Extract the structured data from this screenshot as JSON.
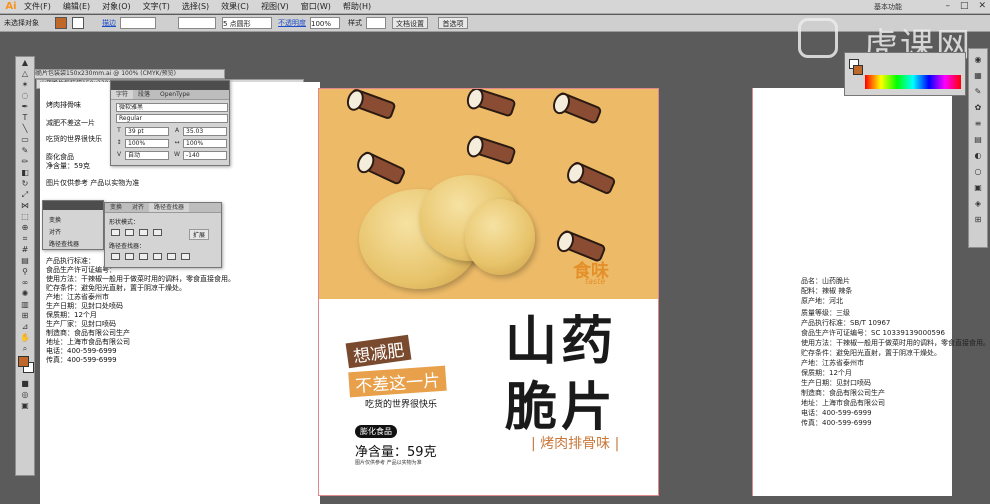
{
  "app": {
    "logo": "Ai",
    "workspace": "基本功能"
  },
  "menu": [
    "文件(F)",
    "编辑(E)",
    "对象(O)",
    "文字(T)",
    "选择(S)",
    "效果(C)",
    "视图(V)",
    "窗口(W)",
    "帮助(H)"
  ],
  "control_bar": {
    "no_selection": "未选择对象",
    "stroke_label": "描边",
    "brush_size": "5 点圆形",
    "opacity_label": "不透明度",
    "opacity_value": "100%",
    "style_label": "样式",
    "doc_setup": "文档设置",
    "preferences": "首选项"
  },
  "brand": {
    "name": "虎课网"
  },
  "doc_tabs": [
    "山药脆片包装袋150x230mm.ai @ 100% (CMYK/预览)",
    "山药脆片包装袋150x230mm.ai @ 166% (CMYK/预览)"
  ],
  "left_doc": {
    "lines": [
      "烤肉排骨味",
      "减肥不差这一片",
      "吃货的世界很快乐",
      "膨化食品",
      "净含量：59克",
      "图片仅供参考 产品以实物为准"
    ],
    "info": [
      "产品执行标准：",
      "食品生产许可证编号：",
      "使用方法：干辣椒一般用于做菜时用的调料，零食直接食用。",
      "贮存条件：避免阳光直射，置于阴凉干燥处。",
      "产地：江苏省泰州市",
      "生产日期：见封口处喷码",
      "保质期：12个月",
      "生产厂家：见封口喷码",
      "制造商：食品有限公司生产",
      "地址：上海市食品有限公司",
      "电话：400-599-6999",
      "传真：400-599-6999"
    ]
  },
  "char_panel": {
    "tabs": [
      "字符",
      "段落",
      "OpenType"
    ],
    "font_family": "微软雅黑",
    "font_style": "Regular",
    "font_size": "39 pt",
    "leading": "35.03",
    "h_scale": "100%",
    "v_scale": "100%",
    "kerning": "自动",
    "tracking": "-140"
  },
  "pathfinder_panel": {
    "tabs": [
      "变换",
      "对齐",
      "路径查找器"
    ],
    "shape_modes": "形状模式：",
    "pathfinders": "路径查找器：",
    "expand": "扩展"
  },
  "mini_list": [
    "变换",
    "对齐",
    "路径查找器"
  ],
  "package": {
    "logo": "食味",
    "logo_sub": "taste",
    "title_line1": "山药",
    "title_line2": "脆片",
    "flavor": "| 烤肉排骨味 |",
    "stamp_line1": "想减肥",
    "stamp_line2": "不差这一片",
    "slogan": "吃货的世界很快乐",
    "badge": "膨化食品",
    "weight": "净含量：59克",
    "fine_print": "图片仅供参考 产品以实物为准",
    "colors": {
      "band": "#edbb68",
      "accent": "#c9783a",
      "yam": "#8a4d33"
    }
  },
  "right_doc": {
    "lines": [
      "品名：山药脆片",
      "配料：辣椒 辣条",
      "原产地：河北",
      "质量等级：三级",
      "产品执行标准：SB/T 10967",
      "食品生产许可证编号：SC 10339139000596",
      "使用方法：干辣椒一般用于做菜时用的调料，零食直接食用。",
      "贮存条件：避免阳光直射，置于阴凉干燥处。",
      "产地：江苏省泰州市",
      "保质期：12个月",
      "生产日期：见封口喷码",
      "制造商：食品有限公司生产",
      "地址：上海市食品有限公司",
      "电话：400-599-6999",
      "传真：400-599-6999"
    ]
  }
}
